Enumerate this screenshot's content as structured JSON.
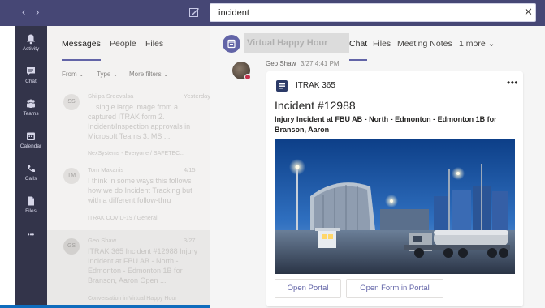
{
  "topbar": {
    "back_glyph": "‹",
    "forward_glyph": "›",
    "search_value": "incident",
    "clear_glyph": "✕",
    "bg_color": "#464775"
  },
  "rail": {
    "items": [
      {
        "label": "Activity",
        "icon": "bell-icon"
      },
      {
        "label": "Chat",
        "icon": "chat-icon"
      },
      {
        "label": "Teams",
        "icon": "teams-icon"
      },
      {
        "label": "Calendar",
        "icon": "calendar-icon"
      },
      {
        "label": "Calls",
        "icon": "phone-icon"
      },
      {
        "label": "Files",
        "icon": "file-icon"
      }
    ],
    "more_glyph": "•••"
  },
  "list_panel": {
    "tabs": [
      "Messages",
      "People",
      "Files"
    ],
    "active_tab": "Messages",
    "filters": [
      "From ⌄",
      "Type ⌄",
      "More filters ⌄"
    ],
    "messages": [
      {
        "initials": "SS",
        "name": "Shilpa Sreevalsa",
        "time": "Yesterday",
        "body": "... single large image from a captured ITRAK form 2. Incident/Inspection approvals in Microsoft Teams 3. MS ...",
        "footer": "NexSystems - Everyone / SAFETEC..."
      },
      {
        "initials": "TM",
        "name": "Tom Makanis",
        "time": "4/15",
        "body": "I think in some ways this follows how we do Incident Tracking but with a different follow-thru",
        "footer": "ITRAK COVID-19 / General"
      },
      {
        "initials": "GS",
        "name": "Geo Shaw",
        "time": "3/27",
        "body": "ITRAK 365 Incident #12988 Injury Incident at FBU AB - North - Edmonton - Edmonton 1B for Branson, Aaron Open ...",
        "footer": "Conversation in Virtual Happy Hour"
      }
    ]
  },
  "chat": {
    "channel_title": "Virtual Happy Hour",
    "tabs": [
      "Chat",
      "Files",
      "Meeting Notes",
      "1 more ⌄"
    ],
    "active_tab": "Chat",
    "sender": {
      "name": "Geo Shaw",
      "time": "3/27 4:41 PM"
    },
    "card": {
      "app_name": "ITRAK 365",
      "more_glyph": "•••",
      "title": "Incident #12988",
      "subtitle": "Injury Incident at FBU AB - North - Edmonton - Edmonton 1B for Branson, Aaron",
      "buttons": [
        "Open Portal",
        "Open Form in Portal"
      ]
    }
  },
  "colors": {
    "accent": "#6264a7",
    "rail": "#33344a",
    "presence_busy": "#c4314b"
  }
}
